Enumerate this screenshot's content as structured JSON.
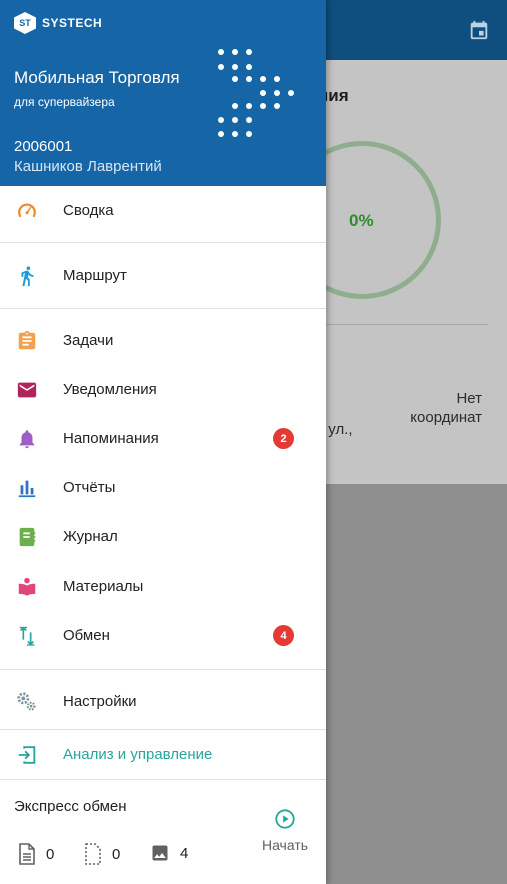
{
  "background": {
    "title_fragment": "ния",
    "progress_percent": "0%",
    "coordinates_text": "Нет\nкоординат",
    "street_fragment": "я ул.,"
  },
  "header": {
    "brand": "SYSTECH",
    "logo_text": "ST",
    "title": "Мобильная Торговля",
    "subtitle": "для супервайзера",
    "user_id": "2006001",
    "user_name": "Кашников Лаврентий"
  },
  "menu": {
    "summary": "Сводка",
    "route": "Маршрут",
    "tasks": "Задачи",
    "notifications": "Уведомления",
    "reminders": "Напоминания",
    "reminders_badge": "2",
    "reports": "Отчёты",
    "journal": "Журнал",
    "materials": "Материалы",
    "exchange": "Обмен",
    "exchange_badge": "4",
    "settings": "Настройки",
    "analysis": "Анализ и управление"
  },
  "express": {
    "title": "Экспресс обмен",
    "documents_count": "0",
    "drafts_count": "0",
    "images_count": "4",
    "start_label": "Начать"
  },
  "colors": {
    "header_bg": "#1565a7",
    "toolbar_bg": "#0e4f7f",
    "badge": "#e53935",
    "accent_teal": "#26a69a"
  }
}
